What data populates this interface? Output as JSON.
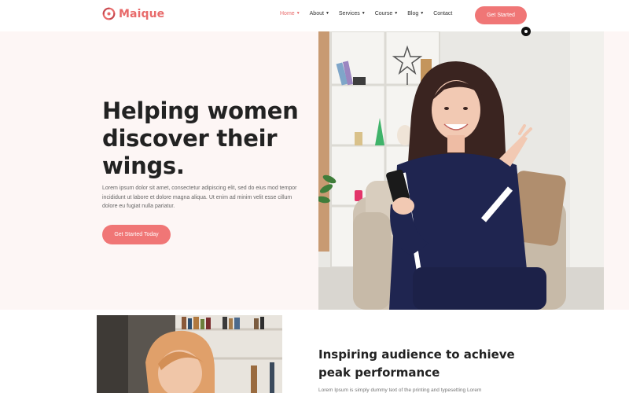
{
  "header": {
    "logo_text": "Maique",
    "nav": [
      {
        "label": "Home",
        "has_caret": true,
        "active": true
      },
      {
        "label": "About",
        "has_caret": true,
        "active": false
      },
      {
        "label": "Services",
        "has_caret": true,
        "active": false
      },
      {
        "label": "Course",
        "has_caret": true,
        "active": false
      },
      {
        "label": "Blog",
        "has_caret": true,
        "active": false
      },
      {
        "label": "Contact",
        "has_caret": false,
        "active": false
      }
    ],
    "cta_label": "Get Started"
  },
  "hero": {
    "title": "Helping women discover their wings.",
    "text": "Lorem ipsum dolor sit amet, consectetur adipiscing elit, sed do eius mod tempor incididunt ut labore et dolore magna aliqua. Ut enim ad minim velit esse cillum dolore eu fugiat nulla pariatur.",
    "cta_label": "Get Started Today"
  },
  "section2": {
    "title": "Inspiring audience to achieve peak performance",
    "text": "Lorem Ipsum is simply dummy text of the printing and typesetting Lorem"
  },
  "colors": {
    "accent": "#f07676",
    "hero_bg": "#fdf6f5",
    "heading": "#222222"
  },
  "icons": {
    "caret": "chevron-down-icon",
    "badge": "dot-icon"
  }
}
